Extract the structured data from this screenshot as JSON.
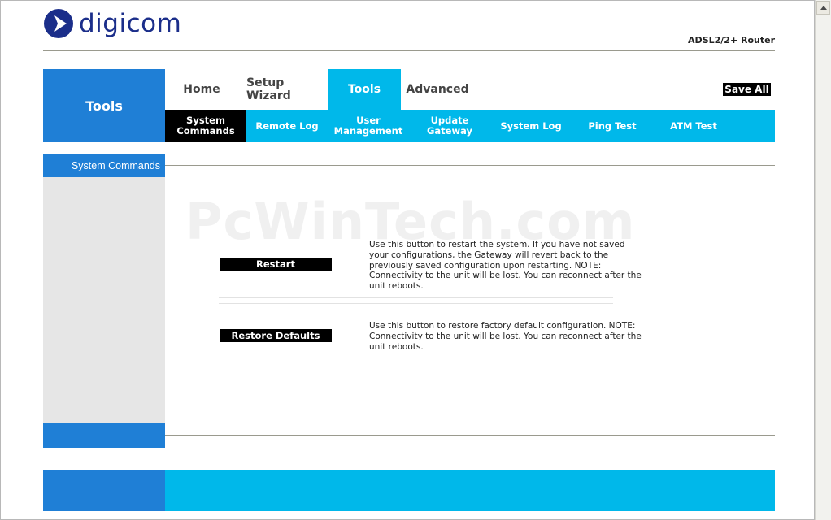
{
  "header": {
    "brand": "digicom",
    "product": "ADSL2/2+ Router"
  },
  "section_title": "Tools",
  "tabs": [
    {
      "label": "Home",
      "active": false
    },
    {
      "label": "Setup Wizard",
      "active": false
    },
    {
      "label": "Tools",
      "active": true
    },
    {
      "label": "Advanced",
      "active": false
    }
  ],
  "save_all_label": "Save All",
  "subnav": [
    {
      "label": "System Commands",
      "active": true
    },
    {
      "label": "Remote Log",
      "active": false
    },
    {
      "label": "User Management",
      "active": false
    },
    {
      "label": "Update Gateway",
      "active": false
    },
    {
      "label": "System Log",
      "active": false
    },
    {
      "label": "Ping Test",
      "active": false
    },
    {
      "label": "ATM Test",
      "active": false
    }
  ],
  "sidebar": {
    "items": [
      {
        "label": "System Commands"
      }
    ]
  },
  "watermark": "PcWinTech.com",
  "commands": [
    {
      "button": "Restart",
      "description": "Use this button to restart the system. If you have not saved your configurations, the Gateway will revert back to the previously saved configuration upon restarting. NOTE: Connectivity to the unit will be lost. You can reconnect after the unit reboots."
    },
    {
      "button": "Restore Defaults",
      "description": "Use this button to restore factory default configuration. NOTE: Connectivity to the unit will be lost. You can reconnect after the unit reboots."
    }
  ],
  "colors": {
    "brand_blue": "#1f7fd6",
    "cyan": "#00b8ea",
    "logo_navy": "#1b2e8a"
  }
}
